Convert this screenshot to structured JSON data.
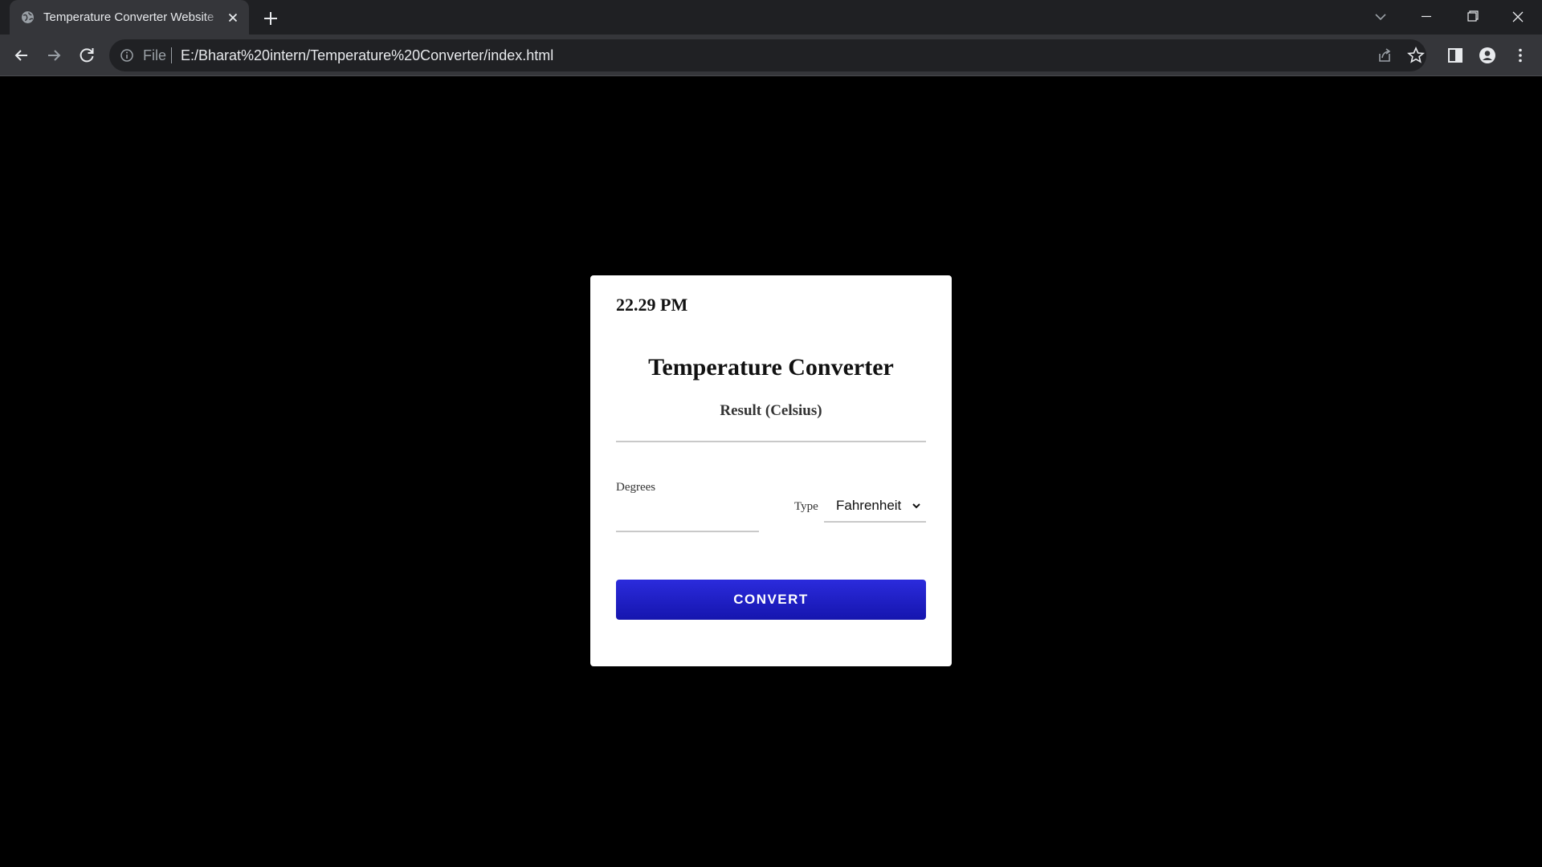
{
  "browser": {
    "tab_title": "Temperature Converter Website",
    "address_scheme": "File",
    "address_url": "E:/Bharat%20intern/Temperature%20Converter/index.html"
  },
  "page": {
    "time": "22.29 PM",
    "heading": "Temperature Converter",
    "result_label": "Result (Celsius)",
    "degrees_label": "Degrees",
    "degrees_value": "",
    "type_label": "Type",
    "type_selected": "Fahrenheit",
    "convert_label": "CONVERT",
    "convert_color": "#1e1ecf",
    "background_color": "#000000"
  }
}
